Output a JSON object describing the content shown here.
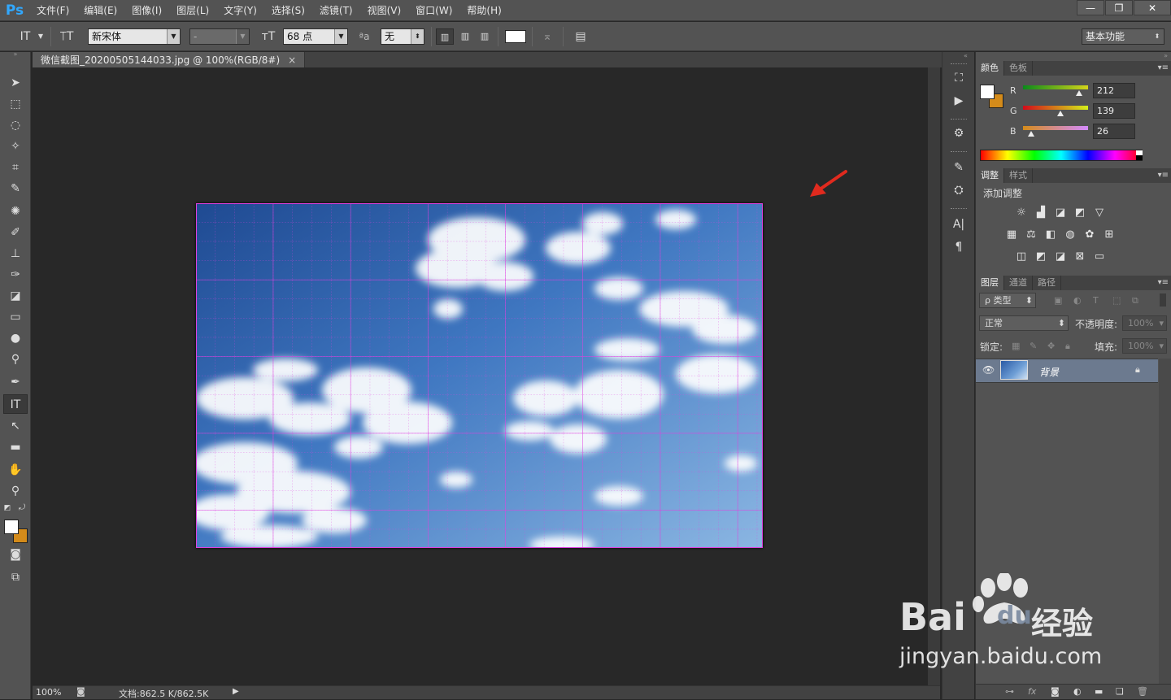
{
  "app": {
    "logo": "Ps"
  },
  "menu": [
    "文件(F)",
    "编辑(E)",
    "图像(I)",
    "图层(L)",
    "文字(Y)",
    "选择(S)",
    "滤镜(T)",
    "视图(V)",
    "窗口(W)",
    "帮助(H)"
  ],
  "window_controls": {
    "minimize": "—",
    "restore": "❐",
    "close": "✕"
  },
  "options_bar": {
    "font_family": "新宋体",
    "font_style": "-",
    "font_size": "68 点",
    "anti_alias_prefix": "ªa",
    "anti_alias": "无",
    "workspace": "基本功能"
  },
  "document_tab": {
    "title": "微信截图_20200505144033.jpg @ 100%(RGB/8#)",
    "close": "×"
  },
  "status": {
    "zoom": "100%",
    "doc_info": "文档:862.5 K/862.5K"
  },
  "colors": {
    "foreground": "#ffffff",
    "background": "#d48b1a",
    "accent_arrow": "#e02a1e",
    "grid": "#e040e0"
  },
  "color_panel": {
    "tabs": [
      "颜色",
      "色板"
    ],
    "r": {
      "label": "R",
      "value": "212"
    },
    "g": {
      "label": "G",
      "value": "139"
    },
    "b": {
      "label": "B",
      "value": "26"
    }
  },
  "adjust_panel": {
    "tabs": [
      "调整",
      "样式"
    ],
    "title": "添加调整"
  },
  "layers_panel": {
    "tabs": [
      "图层",
      "通道",
      "路径"
    ],
    "filter": "ρ 类型",
    "blend_mode": "正常",
    "opacity_label": "不透明度:",
    "opacity_value": "100%",
    "lock_label": "锁定:",
    "fill_label": "填充:",
    "fill_value": "100%",
    "layer_name": "背景"
  },
  "watermark": {
    "brand": "Bai",
    "brand2": "du",
    "cn": "经验",
    "url": "jingyan.baidu.com"
  }
}
